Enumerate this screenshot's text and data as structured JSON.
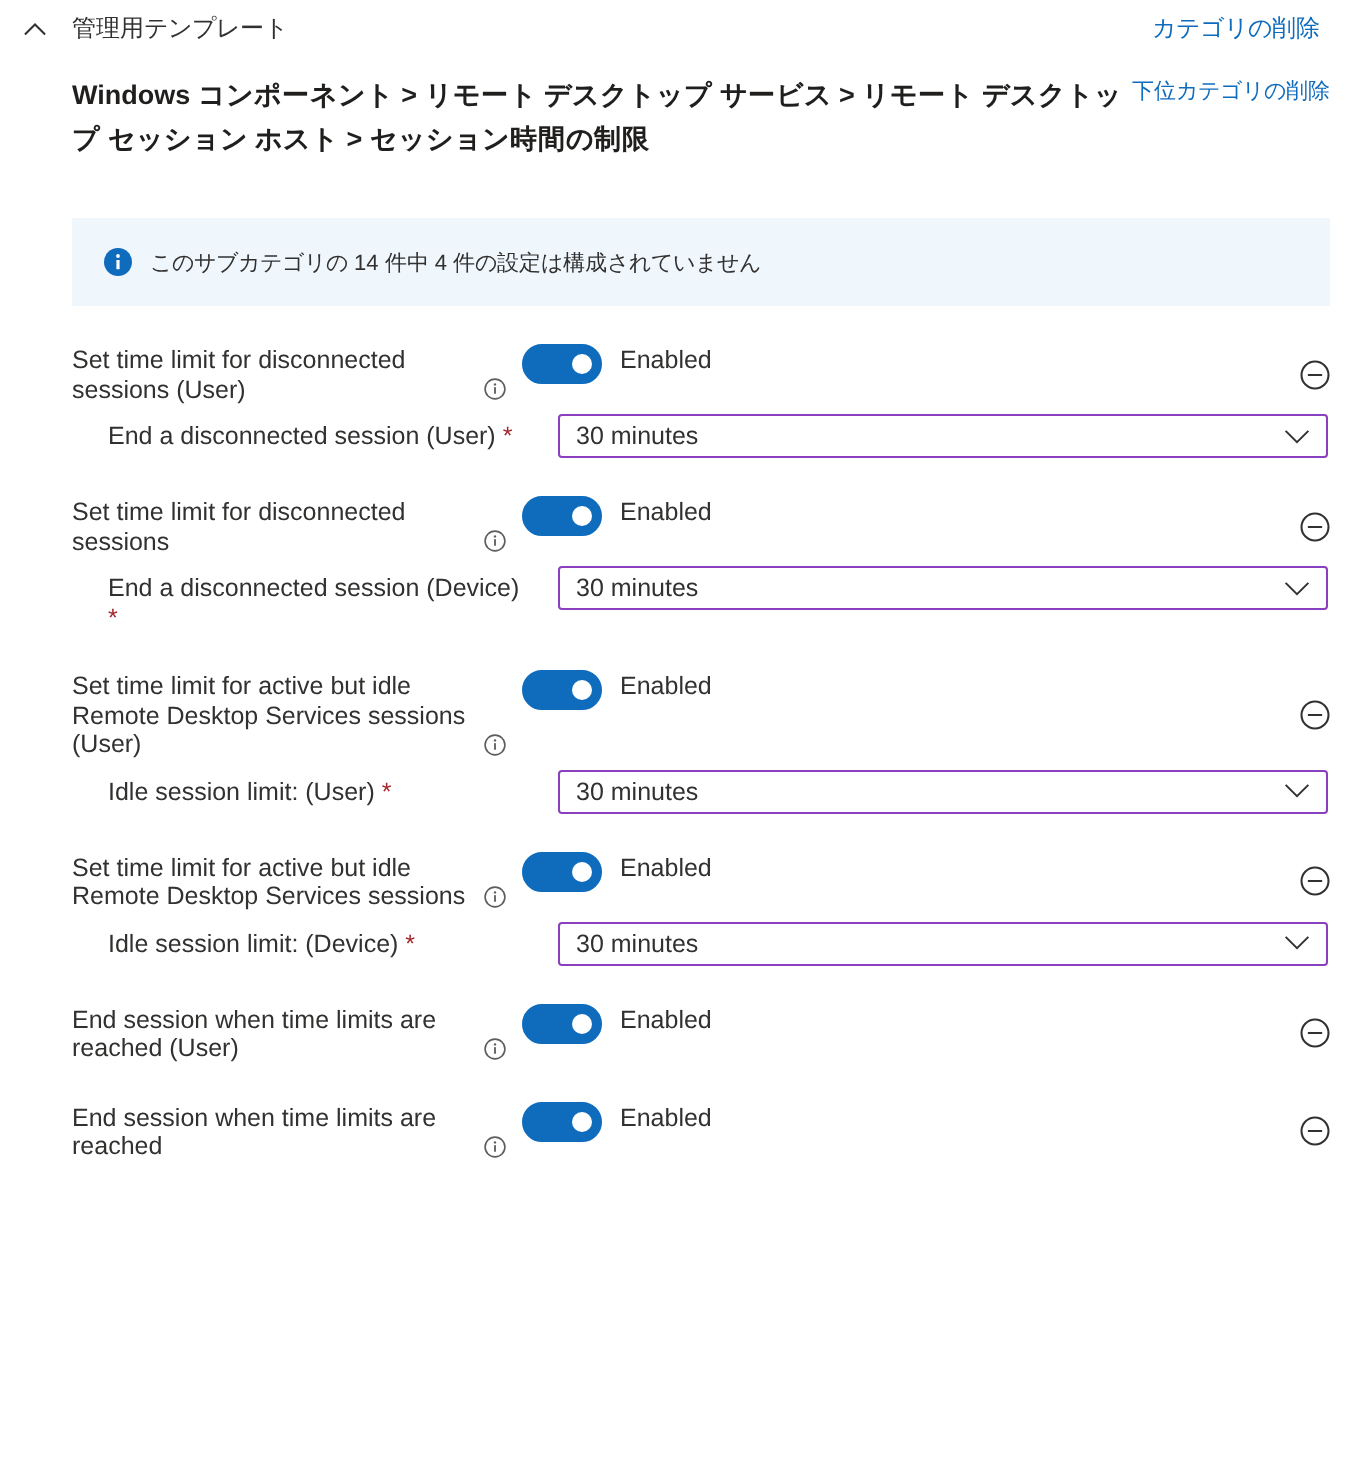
{
  "header": {
    "title": "管理用テンプレート",
    "expanded": true,
    "action": "カテゴリの削除"
  },
  "category": {
    "path": "Windows コンポーネント > リモート デスクトップ サービス > リモート デスクトップ セッション ホスト > セッション時間の制限",
    "action": "下位カテゴリの削除"
  },
  "info_bar": {
    "message": "このサブカテゴリの 14 件中 4 件の設定は構成されていません"
  },
  "settings": [
    {
      "label": "Set time limit for disconnected sessions (User)",
      "on": true,
      "status": "Enabled",
      "sub": {
        "label": "End a disconnected session (User)",
        "required_mark": "*",
        "value": "30 minutes"
      }
    },
    {
      "label": "Set time limit for disconnected sessions",
      "on": true,
      "status": "Enabled",
      "sub": {
        "label": "End a disconnected session (Device)",
        "required_mark": "*",
        "value": "30 minutes"
      }
    },
    {
      "label": "Set time limit for active but idle Remote Desktop Services sessions (User)",
      "on": true,
      "status": "Enabled",
      "sub": {
        "label": "Idle session limit: (User)",
        "required_mark": "*",
        "value": "30 minutes"
      }
    },
    {
      "label": "Set time limit for active but idle Remote Desktop Services sessions",
      "on": true,
      "status": "Enabled",
      "sub": {
        "label": "Idle session limit: (Device)",
        "required_mark": "*",
        "value": "30 minutes"
      }
    },
    {
      "label": "End session when time limits are reached (User)",
      "on": true,
      "status": "Enabled"
    },
    {
      "label": "End session when time limits are reached",
      "on": true,
      "status": "Enabled"
    }
  ]
}
